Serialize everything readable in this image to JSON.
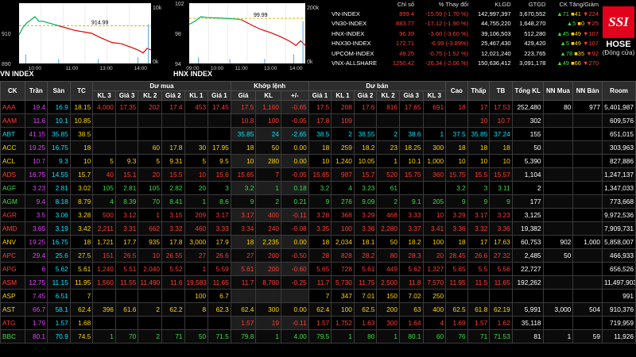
{
  "colors": {
    "red": "#ff3b30",
    "green": "#3fdc3f",
    "yellow": "#ffd400",
    "purple": "#e040fb",
    "cyan": "#00e5ff",
    "white": "#ffffff",
    "logo": "#e3001b"
  },
  "chart_data": [
    {
      "type": "line",
      "title": "VN INDEX",
      "x": [
        "10:00",
        "11:00",
        "13:00",
        "14:00"
      ],
      "ylim": [
        890,
        930
      ],
      "yticks": [
        "910",
        "890"
      ],
      "reference": 914.99,
      "reference_label": "914.99",
      "volume_ticks": [
        "10k",
        "0k"
      ]
    },
    {
      "type": "line",
      "title": "HNX INDEX",
      "x": [
        "09:00",
        "10:00",
        "11:00",
        "13:00",
        "14:00"
      ],
      "ylim": [
        94,
        102
      ],
      "yticks": [
        "102",
        "98",
        "94"
      ],
      "reference": 99.99,
      "reference_label": "99.99",
      "volume_ticks": [
        "200k",
        "0k"
      ]
    }
  ],
  "indices": {
    "headers": [
      "",
      "Chỉ số",
      "% Thay đổi",
      "KLGD",
      "GTGD",
      "CK Tăng/Giảm"
    ],
    "rows": [
      {
        "name": "VN-INDEX",
        "value": "899.4",
        "change": "-15.59 (-1.70 %)",
        "vol": "142,997,397",
        "val": "3,670,552",
        "up": "71",
        "ref": "41",
        "down": "224"
      },
      {
        "name": "VN30-INDEX",
        "value": "883.77",
        "change": "-17.12 (-1.90 %)",
        "vol": "44,755,220",
        "val": "1,648,270",
        "up": "5",
        "ref": "0",
        "down": "25"
      },
      {
        "name": "HNX-INDEX",
        "value": "96.39",
        "change": "-3.60 (-3.60 %)",
        "vol": "39,106,503",
        "val": "512,280",
        "up": "45",
        "ref": "49",
        "down": "107"
      },
      {
        "name": "HNX30-INDEX",
        "value": "172.71",
        "change": "-6.99 (-3.89%)",
        "vol": "25,467,430",
        "val": "429,420",
        "up": "5",
        "ref": "49",
        "down": "107"
      },
      {
        "name": "UPCOM-INDEX",
        "value": "49.25",
        "change": "-0.75 (-1.52 %)",
        "vol": "12,021,240",
        "val": "223,765",
        "up": "78",
        "ref": "35",
        "down": "92"
      },
      {
        "name": "VNX-ALLSHARE",
        "value": "1250.42",
        "change": "-26.34 (-2.06 %)",
        "vol": "150,636,412",
        "val": "3,091,178",
        "up": "49",
        "ref": "66",
        "down": "270"
      }
    ]
  },
  "logo": {
    "brand": "SSI",
    "exchange": "HOSE",
    "status": "(Đóng cửa)"
  },
  "board": {
    "groups": {
      "buy": "Dư mua",
      "match": "Khớp lệnh",
      "sell": "Dư bán"
    },
    "cols": {
      "ck": "CK",
      "tran": "Trần",
      "san": "Sàn",
      "tc": "TC",
      "kl3": "KL 3",
      "g3": "Giá 3",
      "kl2": "KL 2",
      "g2": "Giá 2",
      "kl1": "KL 1",
      "g1": "Giá 1",
      "gia": "Giá",
      "kl": "KL",
      "pm": "+/-",
      "cao": "Cao",
      "thap": "Thấp",
      "tb": "TB",
      "tong": "Tổng KL",
      "nnmua": "NN Mua",
      "nnban": "NN Bán",
      "room": "Room"
    },
    "rows": [
      {
        "c": "r",
        "v": [
          "AAA",
          "19.4",
          "16.9",
          "18.15",
          "4,000",
          "17.35",
          "202",
          "17.4",
          "453",
          "17.45",
          "17.5",
          "1,160",
          "-0.65",
          "17.5",
          "208",
          "17.6",
          "816",
          "17.65",
          "691",
          "18",
          "17",
          "17.53",
          "252,480",
          "80",
          "977",
          "5,401,987"
        ]
      },
      {
        "c": "r",
        "v": [
          "AAM",
          "11.6",
          "10.1",
          "10.85",
          "",
          "",
          "",
          "",
          "",
          "",
          "10.8",
          "100",
          "-0.05",
          "17.8",
          "109",
          "",
          "",
          "",
          "",
          "",
          "10",
          "10.7",
          "302",
          "",
          "",
          "609,576"
        ]
      },
      {
        "c": "c",
        "v": [
          "ABT",
          "41.15",
          "35.85",
          "38.5",
          "",
          "",
          "",
          "",
          "",
          "",
          "35.85",
          "24",
          "-2.65",
          "38.5",
          "2",
          "38.55",
          "2",
          "38.6",
          "1",
          "37.5",
          "35.85",
          "37.24",
          "155",
          "",
          "",
          "651,015"
        ]
      },
      {
        "c": "y",
        "v": [
          "ACC",
          "19.25",
          "16.75",
          "18",
          "",
          "",
          "60",
          "17.8",
          "30",
          "17.95",
          "18",
          "50",
          "0.00",
          "18",
          "259",
          "18.2",
          "23",
          "18.25",
          "300",
          "18",
          "18",
          "18",
          "50",
          "",
          "",
          "303,963"
        ]
      },
      {
        "c": "y",
        "v": [
          "ACL",
          "10.7",
          "9.3",
          "10",
          "5",
          "9.3",
          "5",
          "9.31",
          "5",
          "9.5",
          "10",
          "280",
          "0.00",
          "10",
          "1,240",
          "10.05",
          "1",
          "10.1",
          "1,000",
          "10",
          "10",
          "10",
          "5,390",
          "",
          "",
          "827,886"
        ]
      },
      {
        "c": "r",
        "v": [
          "ADS",
          "16.75",
          "14.55",
          "15.7",
          "40",
          "15.1",
          "20",
          "15.5",
          "10",
          "15.6",
          "15.65",
          "7",
          "-0.05",
          "15.65",
          "987",
          "15.7",
          "520",
          "15.75",
          "360",
          "15.75",
          "15.5",
          "15.57",
          "1,104",
          "",
          "",
          "1,247,137"
        ]
      },
      {
        "c": "g",
        "v": [
          "AGF",
          "3.23",
          "2.81",
          "3.02",
          "105",
          "2.81",
          "105",
          "2.82",
          "20",
          "3",
          "3.2",
          "1",
          "0.18",
          "3.2",
          "4",
          "3.23",
          "61",
          "",
          "",
          "3.2",
          "3",
          "3.11",
          "2",
          "",
          "",
          "1,347,033"
        ]
      },
      {
        "c": "g",
        "v": [
          "AGM",
          "9.4",
          "8.18",
          "8.79",
          "4",
          "8.39",
          "70",
          "8.41",
          "1",
          "8.6",
          "9",
          "2",
          "0.21",
          "9",
          "276",
          "9.09",
          "2",
          "9.1",
          "205",
          "9",
          "9",
          "9",
          "177",
          "",
          "",
          "773,668"
        ]
      },
      {
        "c": "r",
        "v": [
          "AGR",
          "3.5",
          "3.06",
          "3.28",
          "500",
          "3.12",
          "1",
          "3.15",
          "209",
          "3.17",
          "3.17",
          "400",
          "-0.11",
          "3.28",
          "368",
          "3.29",
          "468",
          "3.33",
          "10",
          "3.29",
          "3.17",
          "3.23",
          "3,125",
          "",
          "",
          "9,972,536"
        ]
      },
      {
        "c": "r",
        "v": [
          "AMD",
          "3.65",
          "3.19",
          "3.42",
          "2,211",
          "3.31",
          "662",
          "3.32",
          "460",
          "3.33",
          "3.34",
          "240",
          "-0.08",
          "3.35",
          "100",
          "3.36",
          "2,280",
          "3.37",
          "3.41",
          "3.36",
          "3.32",
          "3.36",
          "19,382",
          "",
          "",
          "7,909,731"
        ]
      },
      {
        "c": "y",
        "v": [
          "ANV",
          "19.25",
          "16.75",
          "18",
          "1,721",
          "17.7",
          "935",
          "17.8",
          "3,000",
          "17.9",
          "18",
          "2,235",
          "0.00",
          "18",
          "2,034",
          "18.1",
          "50",
          "18.2",
          "100",
          "18",
          "17",
          "17.63",
          "60,753",
          "902",
          "1,000",
          "5,858,007"
        ]
      },
      {
        "c": "r",
        "v": [
          "APC",
          "29.4",
          "25.6",
          "27.5",
          "151",
          "26.5",
          "10",
          "26.55",
          "27",
          "26.6",
          "27",
          "200",
          "-0.50",
          "28",
          "828",
          "28.2",
          "80",
          "28.3",
          "20",
          "28.45",
          "26.6",
          "27.32",
          "2,485",
          "50",
          "",
          "466,933"
        ]
      },
      {
        "c": "r",
        "v": [
          "APG",
          "6",
          "5.62",
          "5.61",
          "1,240",
          "5.51",
          "2,040",
          "5.52",
          "1",
          "5.59",
          "5.61",
          "200",
          "-0.60",
          "5.65",
          "728",
          "5.61",
          "449",
          "5.62",
          "1,327",
          "5.65",
          "5.5",
          "5.56",
          "22,727",
          "",
          "",
          "656,526"
        ]
      },
      {
        "c": "r",
        "v": [
          "ASM",
          "12.75",
          "11.15",
          "11.95",
          "1,560",
          "11.55",
          "11,490",
          "11.6",
          "19,583",
          "11.65",
          "11.7",
          "8,700",
          "-0.25",
          "11.7",
          "5,730",
          "11.75",
          "2,500",
          "11.8",
          "7,570",
          "11.95",
          "11.5",
          "11.65",
          "192,262",
          "",
          "",
          "11,497,903"
        ]
      },
      {
        "c": "y",
        "v": [
          "ASP",
          "7.45",
          "6.51",
          "7",
          "",
          "",
          "",
          "",
          "100",
          "6.7",
          "",
          "",
          "",
          "7",
          "347",
          "7.01",
          "150",
          "7.02",
          "250",
          "",
          "",
          "",
          "",
          "",
          "",
          "991"
        ]
      },
      {
        "c": "y",
        "v": [
          "AST",
          "66.7",
          "58.1",
          "62.4",
          "396",
          "61.6",
          "2",
          "62.2",
          "8",
          "62.3",
          "62.4",
          "300",
          "0.00",
          "62.4",
          "100",
          "62.5",
          "200",
          "63",
          "400",
          "62.5",
          "61.8",
          "62.19",
          "5,991",
          "3,000",
          "504",
          "910,376"
        ]
      },
      {
        "c": "r",
        "v": [
          "ATG",
          "1.79",
          "1.57",
          "1.68",
          "",
          "",
          "",
          "",
          "",
          "",
          "1.57",
          "19",
          "-0.11",
          "1.57",
          "1,752",
          "1.63",
          "300",
          "1.64",
          "4",
          "1.69",
          "1.57",
          "1.62",
          "35,118",
          "",
          "",
          "719,959"
        ]
      },
      {
        "c": "g",
        "v": [
          "BBC",
          "80.1",
          "70.9",
          "74.5",
          "1",
          "70",
          "2",
          "71",
          "50",
          "71.5",
          "79.8",
          "1",
          "4.00",
          "79.5",
          "1",
          "80",
          "1",
          "80.1",
          "60",
          "76",
          "71",
          "71.53",
          "81",
          "1",
          "59",
          "11,926"
        ]
      }
    ]
  }
}
